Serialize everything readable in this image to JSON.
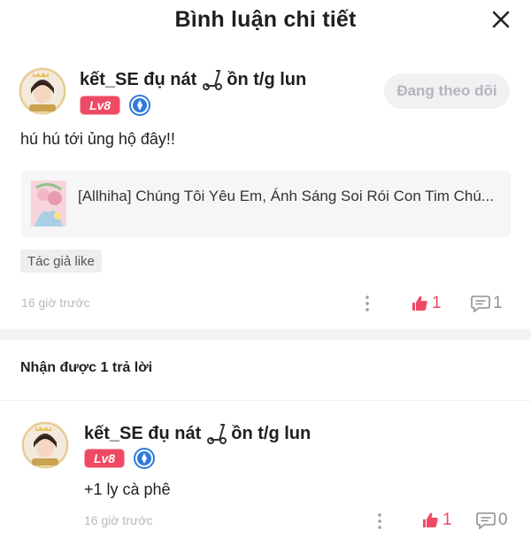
{
  "header": {
    "title": "Bình luận chi tiết"
  },
  "comment": {
    "username_part1": "kết_SE đụ nát",
    "username_part2": "ồn t/g lun",
    "level": "Lv8",
    "follow_label": "Đang theo dõi",
    "text": "hú hú tới ủng hộ đây!!",
    "reference_title": "[Allhiha] Chúng Tôi Yêu Em, Ánh Sáng Soi Rói Con Tim Chú...",
    "tag": "Tác giả like",
    "time": "16 giờ trước",
    "likes": "1",
    "replies": "1"
  },
  "replies_section": {
    "heading": "Nhận được 1 trả lời"
  },
  "reply": {
    "username_part1": "kết_SE đụ nát",
    "username_part2": "ồn t/g lun",
    "level": "Lv8",
    "text": "+1 ly cà phê",
    "time": "16 giờ trước",
    "likes": "1",
    "replies": "0"
  },
  "colors": {
    "accent": "#ef4a63",
    "muted": "#b9b9bf",
    "badge_blue": "#2f7bdc"
  }
}
